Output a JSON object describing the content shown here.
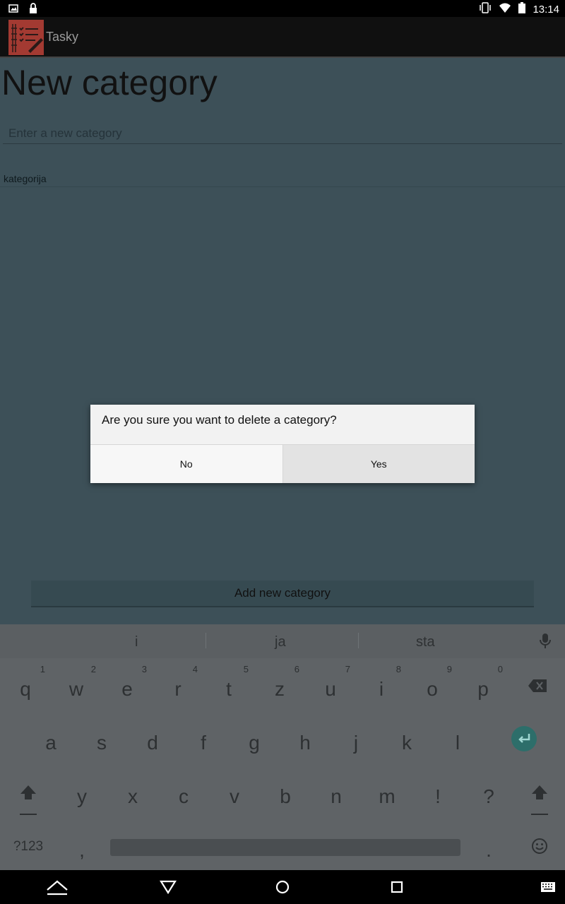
{
  "status_bar": {
    "time": "13:14",
    "left_icons": [
      "image-icon",
      "lock-icon"
    ],
    "right_icons": [
      "vibrate-icon",
      "wifi-icon",
      "battery-icon"
    ]
  },
  "app": {
    "title": "Tasky",
    "icon": "checklist-icon",
    "accent": "#a33a32"
  },
  "page": {
    "title": "New category",
    "input_placeholder": "Enter a new category",
    "input_value": "",
    "categories": [
      "kategorija"
    ],
    "add_button_label": "Add new category"
  },
  "dialog": {
    "message": "Are you sure you want to delete a category?",
    "no_label": "No",
    "yes_label": "Yes"
  },
  "keyboard": {
    "suggestions": [
      "i",
      "ja",
      "sta"
    ],
    "row1": [
      {
        "key": "q",
        "hint": "1"
      },
      {
        "key": "w",
        "hint": "2"
      },
      {
        "key": "e",
        "hint": "3"
      },
      {
        "key": "r",
        "hint": "4"
      },
      {
        "key": "t",
        "hint": "5"
      },
      {
        "key": "z",
        "hint": "6"
      },
      {
        "key": "u",
        "hint": "7"
      },
      {
        "key": "i",
        "hint": "8"
      },
      {
        "key": "o",
        "hint": "9"
      },
      {
        "key": "p",
        "hint": "0"
      }
    ],
    "row2": [
      "a",
      "s",
      "d",
      "f",
      "g",
      "h",
      "j",
      "k",
      "l"
    ],
    "row3": [
      "y",
      "x",
      "c",
      "v",
      "b",
      "n",
      "m",
      "!",
      "?"
    ],
    "symbols_key": "?123",
    "comma_key": ",",
    "period_key": ".",
    "enter_color": "#2d6e6a"
  },
  "nav_bar": {
    "buttons": [
      "hide-keyboard-icon",
      "back-icon",
      "home-icon",
      "recents-icon",
      "keyboard-icon"
    ]
  }
}
